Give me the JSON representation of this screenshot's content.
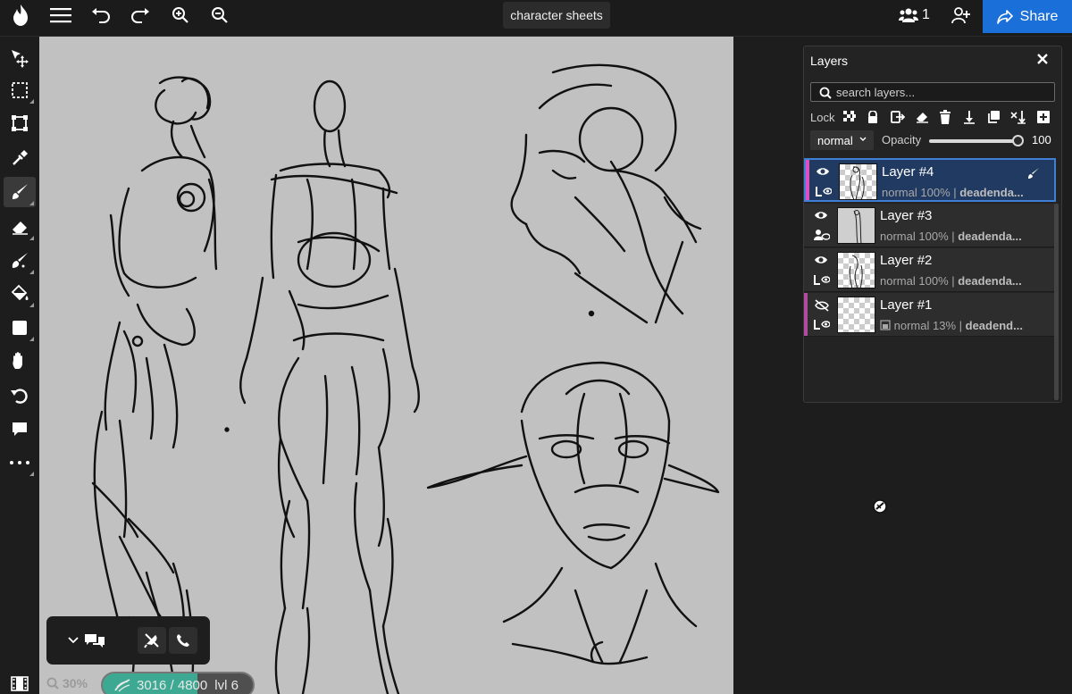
{
  "topbar": {
    "document_title": "character sheets",
    "users_count": "1",
    "share_label": "Share"
  },
  "layers_panel": {
    "title": "Layers",
    "search_placeholder": "search layers...",
    "lock_label": "Lock",
    "blend_mode": "normal",
    "opacity_label": "Opacity",
    "opacity_value": "100",
    "layers": [
      {
        "name": "Layer #4",
        "blend": "normal",
        "opacity": "100%",
        "owner": "deadenda...",
        "visible": true,
        "selected": true,
        "strip_color": "#e04fbf"
      },
      {
        "name": "Layer #3",
        "blend": "normal",
        "opacity": "100%",
        "owner": "deadenda...",
        "visible": true,
        "selected": false,
        "strip_color": ""
      },
      {
        "name": "Layer #2",
        "blend": "normal",
        "opacity": "100%",
        "owner": "deadenda...",
        "visible": true,
        "selected": false,
        "strip_color": ""
      },
      {
        "name": "Layer #1",
        "blend": "normal",
        "opacity": "13%",
        "owner": "deadend...",
        "visible": false,
        "selected": false,
        "strip_color": "#b04ba0"
      }
    ]
  },
  "statusbar": {
    "zoom": "30%",
    "progress_text": "3016 / 4800",
    "level": "lvl 6",
    "progress_fraction": 0.628
  },
  "tools": [
    "move-icon",
    "select-rect-icon",
    "transform-icon",
    "eyedropper-icon",
    "brush-icon",
    "eraser-icon",
    "smudge-icon",
    "fill-icon",
    "shape-icon",
    "hand-icon",
    "rotate-icon",
    "comment-icon",
    "more-icon"
  ],
  "colors": {
    "accent": "#1a6fd9",
    "canvas": "#c1c1c1",
    "selected_layer": "#203a62",
    "progress": "#3ea993"
  }
}
